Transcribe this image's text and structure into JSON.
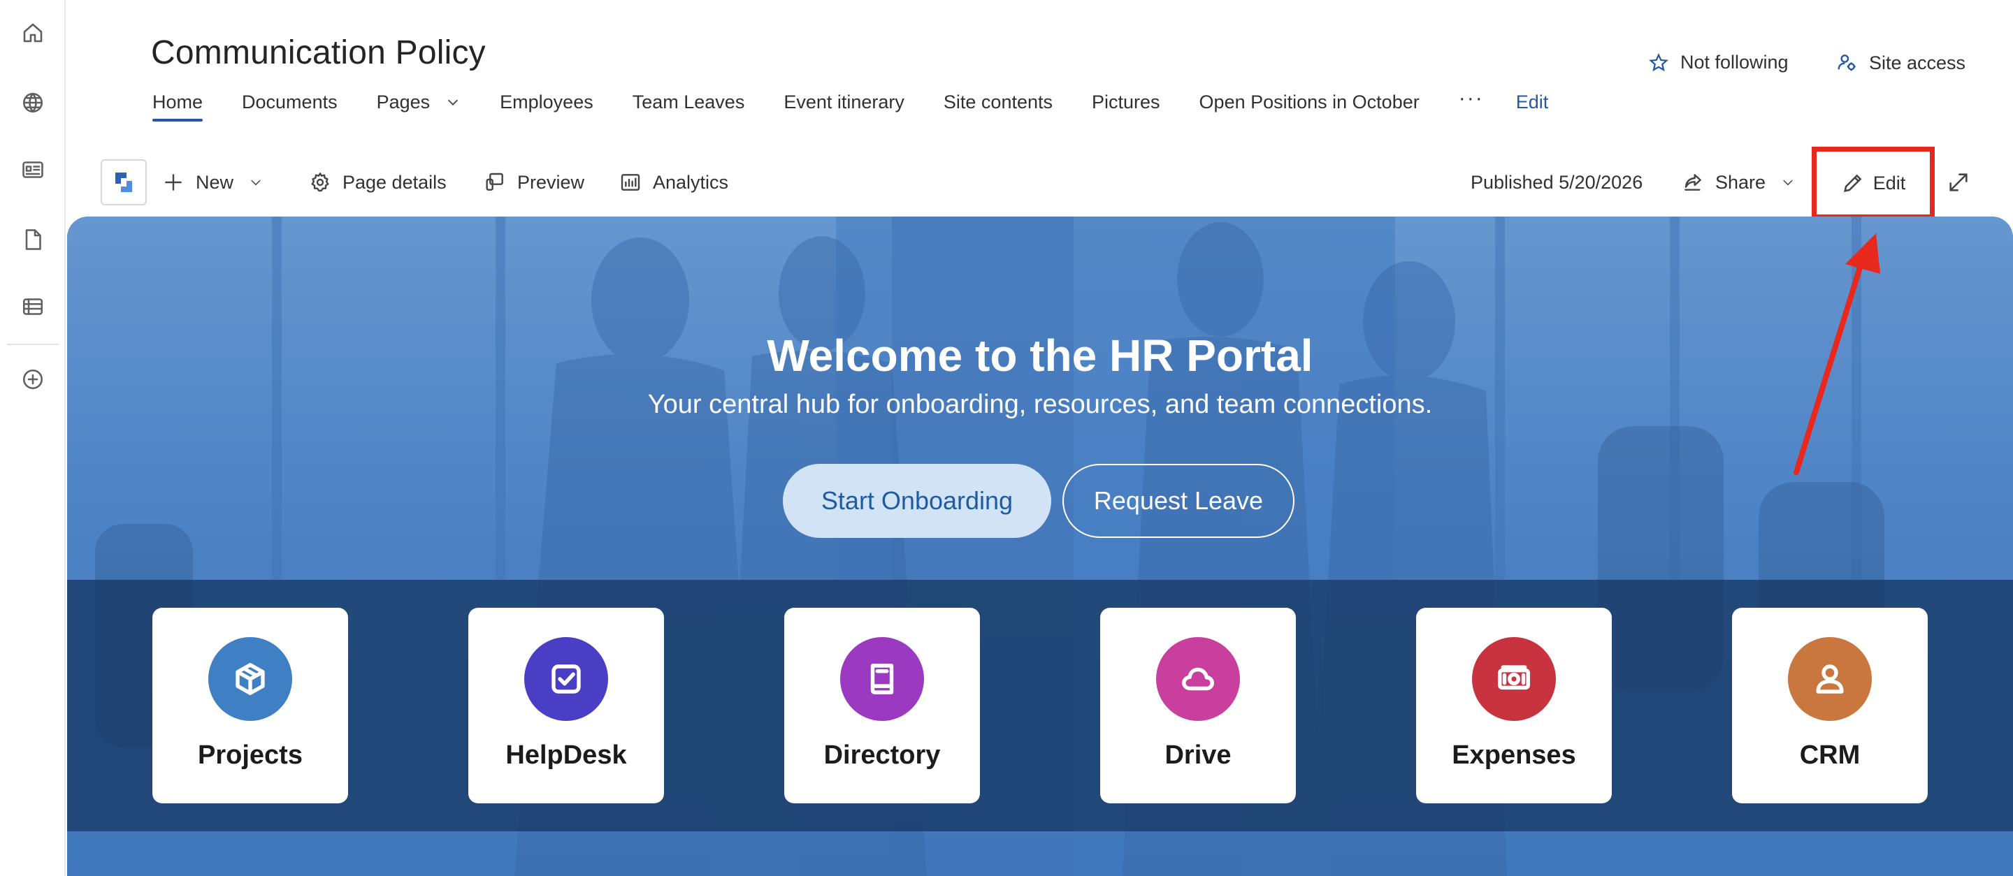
{
  "site": {
    "title": "Communication Policy"
  },
  "nav": {
    "items": [
      {
        "label": "Home",
        "active": true
      },
      {
        "label": "Documents"
      },
      {
        "label": "Pages",
        "dropdown": true
      },
      {
        "label": "Employees"
      },
      {
        "label": "Team Leaves"
      },
      {
        "label": "Event itinerary"
      },
      {
        "label": "Site contents"
      },
      {
        "label": "Pictures"
      },
      {
        "label": "Open Positions in October"
      }
    ],
    "more_label": "···",
    "edit_label": "Edit"
  },
  "header_actions": {
    "follow_label": "Not following",
    "site_access_label": "Site access"
  },
  "commandbar": {
    "new_label": "New",
    "page_details_label": "Page details",
    "preview_label": "Preview",
    "analytics_label": "Analytics",
    "published_label": "Published 5/20/2026",
    "share_label": "Share",
    "edit_label": "Edit"
  },
  "hero": {
    "title": "Welcome to the HR Portal",
    "subtitle": "Your central hub for onboarding, resources, and team connections.",
    "primary_button": "Start Onboarding",
    "secondary_button": "Request Leave"
  },
  "tiles": [
    {
      "label": "Projects",
      "icon": "box-icon",
      "color": "#3f7fc4"
    },
    {
      "label": "HelpDesk",
      "icon": "checkbox-icon",
      "color": "#4a3fc4"
    },
    {
      "label": "Directory",
      "icon": "book-icon",
      "color": "#9b3ac0"
    },
    {
      "label": "Drive",
      "icon": "cloud-icon",
      "color": "#c93f9e"
    },
    {
      "label": "Expenses",
      "icon": "money-icon",
      "color": "#c9323f"
    },
    {
      "label": "CRM",
      "icon": "person-icon",
      "color": "#c9773e"
    }
  ],
  "colors": {
    "accent": "#2557a7",
    "highlight_box": "#e8281c",
    "hero_blue": "#4a80c4"
  }
}
